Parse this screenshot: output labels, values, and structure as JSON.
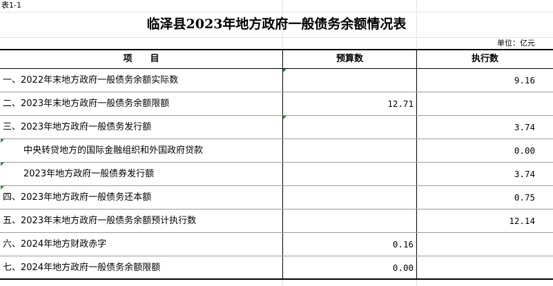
{
  "sheet_label": "表1-1",
  "title": "临泽县2023年地方政府一般债务余额情况表",
  "unit": "单位：亿元",
  "headers": {
    "item": "项　　目",
    "budget": "预算数",
    "actual": "执行数"
  },
  "rows": [
    {
      "item": "一、2022年末地方政府一般债务余额实际数",
      "budget": "",
      "actual": "9.16"
    },
    {
      "item": "二、2023年末地方政府一般债务余额限额",
      "budget": "12.71",
      "actual": ""
    },
    {
      "item": "三、2023年地方政府一般债务发行额",
      "budget": "",
      "actual": "3.74"
    },
    {
      "item": "中央转贷地方的国际金融组织和外国政府贷款",
      "budget": "",
      "actual": "0.00"
    },
    {
      "item": "2023年地方政府一般债券发行额",
      "budget": "",
      "actual": "3.74"
    },
    {
      "item": "四、2023年地方政府一般债务还本额",
      "budget": "",
      "actual": "0.75"
    },
    {
      "item": "五、2023年末地方政府一般债务余额预计执行数",
      "budget": "",
      "actual": "12.14"
    },
    {
      "item": "六、2024年地方财政赤字",
      "budget": "0.16",
      "actual": ""
    },
    {
      "item": "七、2024年地方政府一般债务余额限额",
      "budget": "0.00",
      "actual": ""
    }
  ]
}
